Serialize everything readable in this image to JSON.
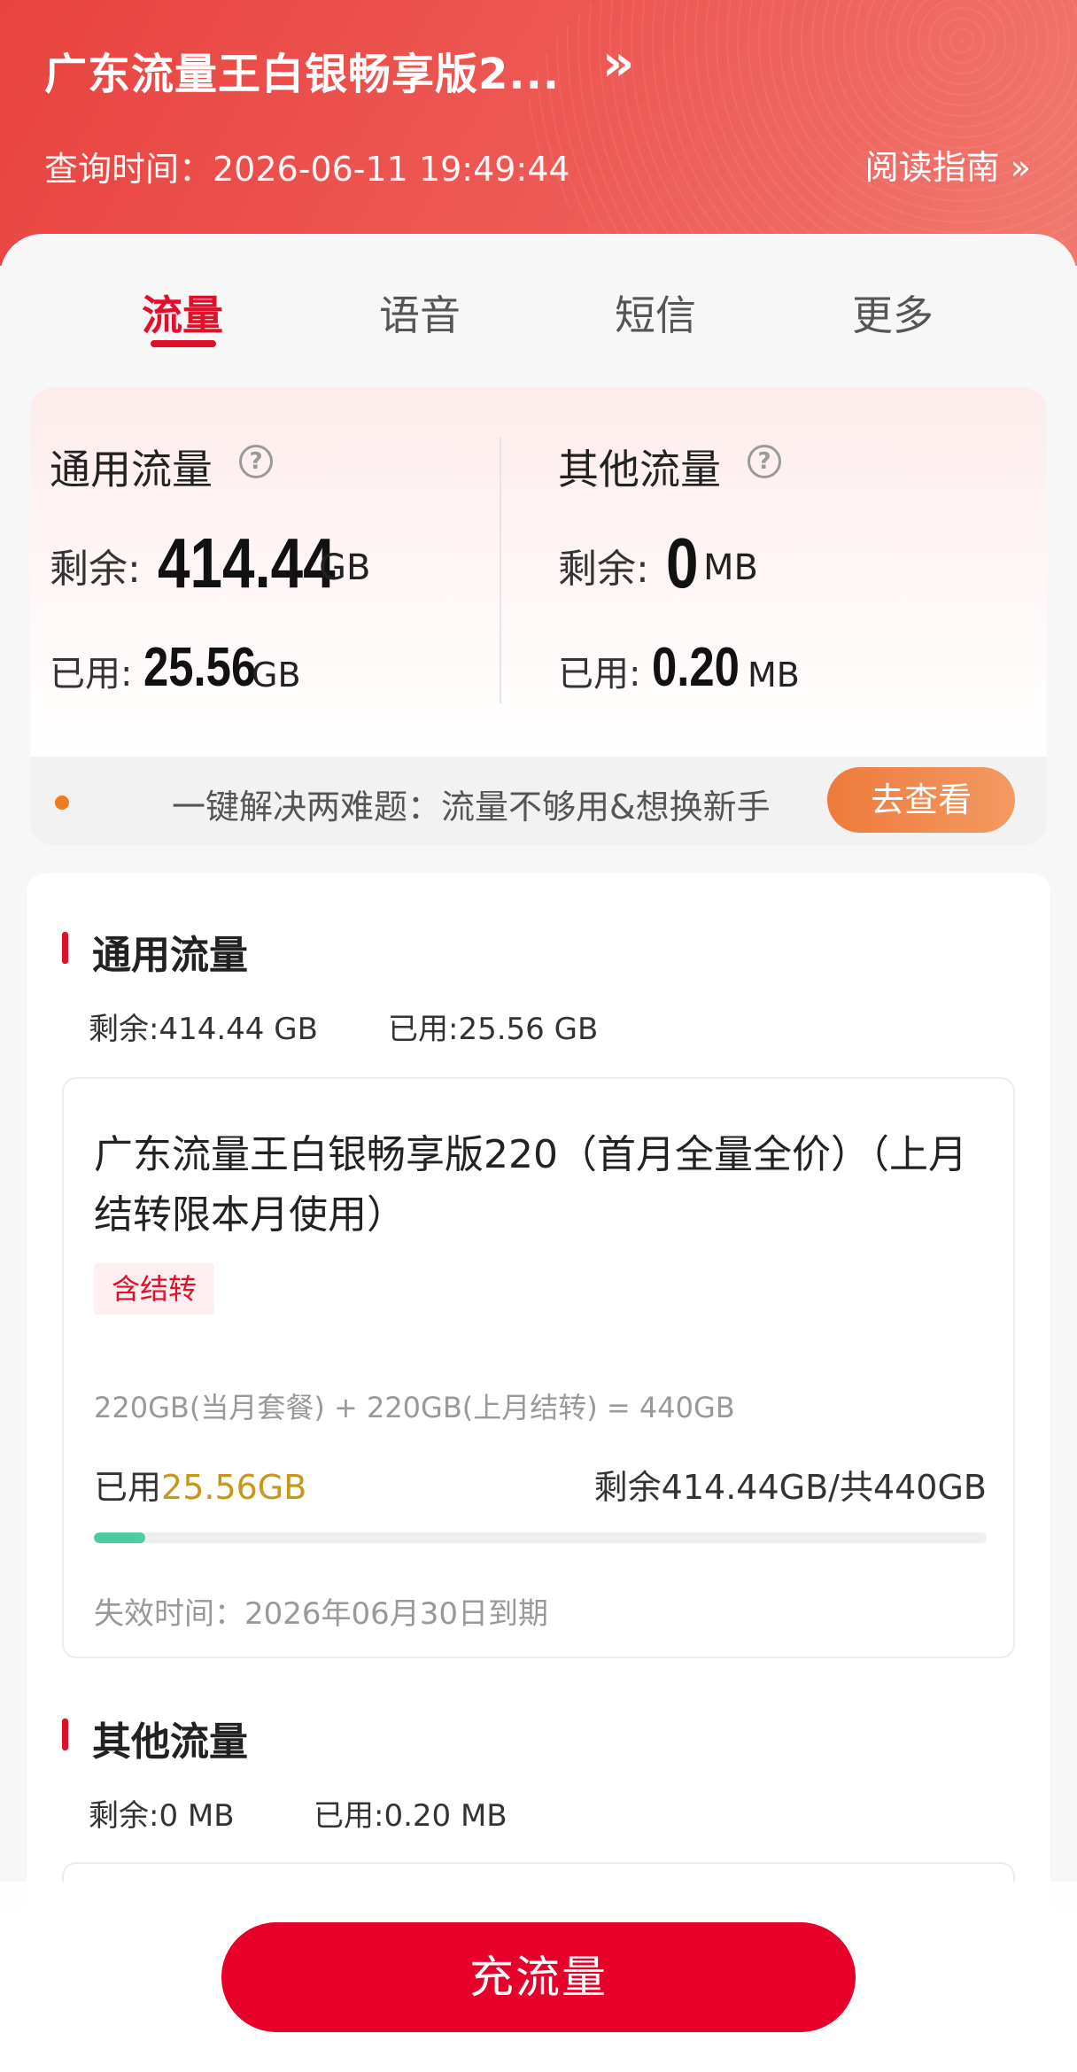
{
  "header": {
    "plan_title": "广东流量王白银畅享版2...",
    "arrow": "»",
    "query_time": "查询时间：2026-06-11 19:49:44",
    "guide_link": "阅读指南 »"
  },
  "tabs": [
    {
      "label": "流量",
      "active": true
    },
    {
      "label": "语音",
      "active": false
    },
    {
      "label": "短信",
      "active": false
    },
    {
      "label": "更多",
      "active": false
    }
  ],
  "summary": {
    "general": {
      "title": "通用流量",
      "remain_label": "剩余:",
      "remain_value": "414.44",
      "remain_unit": "GB",
      "used_label": "已用:",
      "used_value": "25.56",
      "used_unit": "GB"
    },
    "other": {
      "title": "其他流量",
      "remain_label": "剩余:",
      "remain_value": "0",
      "remain_unit": "MB",
      "used_label": "已用:",
      "used_value": "0.20",
      "used_unit": "MB"
    },
    "help_icon": "?"
  },
  "notice": {
    "text": "一键解决两难题：流量不够用&想换新手",
    "button": "去查看",
    "dot_color": "#f07a1e"
  },
  "general_section": {
    "title": "通用流量",
    "remain": "剩余:414.44 GB",
    "used": "已用:25.56 GB",
    "package": {
      "name": "广东流量王白银畅享版220（首月全量全价）（上月结转限本月使用）",
      "tag": "含结转",
      "formula": "220GB(当月套餐) + 220GB(上月结转) = 440GB",
      "used_label": "已用",
      "used_amount": "25.56GB",
      "remain_text": "剩余414.44GB/共440GB",
      "progress_fraction": 0.058,
      "expire": "失效时间：2026年06月30日到期"
    }
  },
  "other_section": {
    "title": "其他流量",
    "remain": "剩余:0 MB",
    "used": "已用:0.20 MB"
  },
  "cta": {
    "label": "充流量"
  },
  "colors": {
    "accent": "#e0102a",
    "header": "#ec4f4a",
    "progress": "#4dcca0",
    "used_amount": "#c9961a"
  }
}
